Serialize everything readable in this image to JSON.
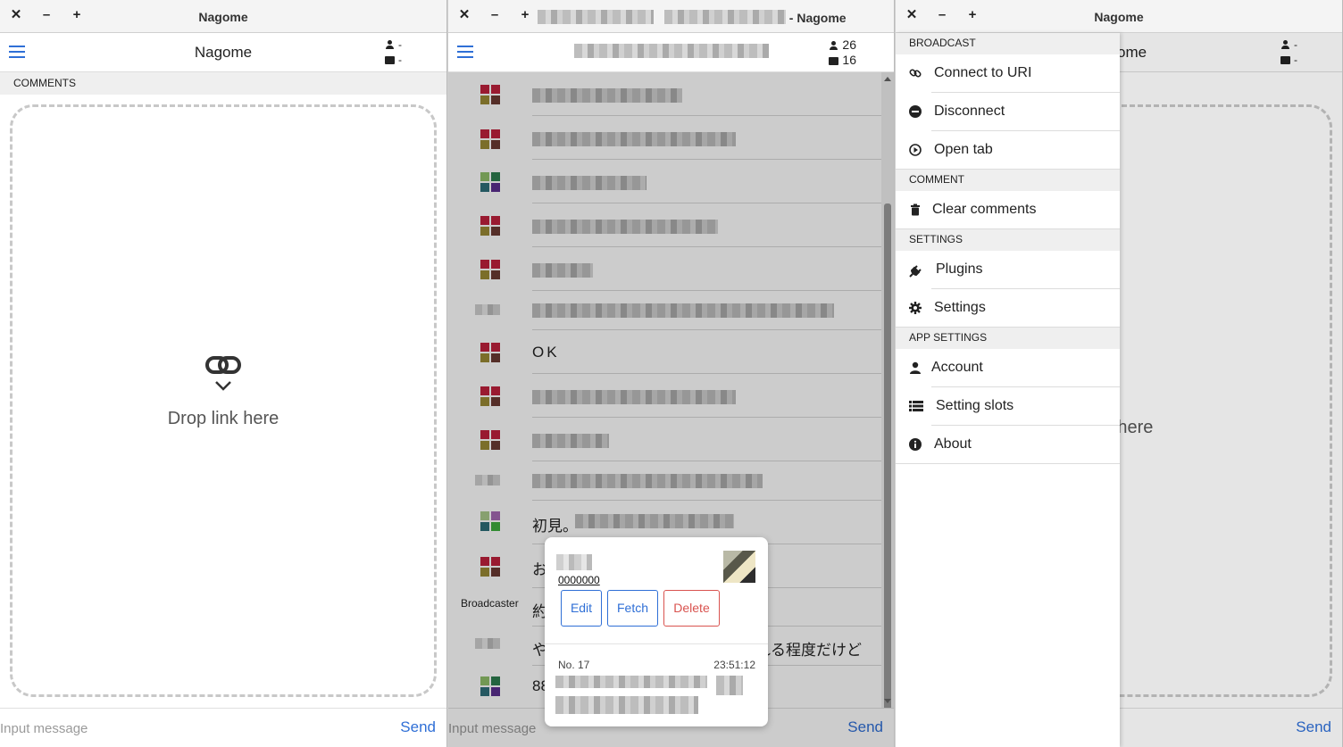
{
  "window_controls": {
    "close": "✕",
    "minimize": "–",
    "maximize": "+"
  },
  "windows": [
    {
      "title": "Nagome",
      "app_title": "Nagome",
      "viewers": "-",
      "comments": "-",
      "section": "COMMENTS",
      "drop_text": "Drop link here",
      "input_placeholder": "Input message",
      "send_label": "Send"
    },
    {
      "title_suffix": "- Nagome",
      "viewers": "26",
      "comments": "16",
      "input_placeholder": "Input message",
      "send_label": "Send",
      "visible_comments": [
        {
          "text": "OK"
        },
        {
          "text": "初見。"
        },
        {
          "text": "お"
        },
        {
          "text": "約",
          "label": "Broadcaster"
        },
        {
          "text": "や",
          "tail": "れる程度だけど"
        },
        {
          "text": "88"
        }
      ],
      "popup": {
        "user_id": "0000000",
        "edit_label": "Edit",
        "fetch_label": "Fetch",
        "delete_label": "Delete",
        "comment_no": "No. 17",
        "time": "23:51:12"
      }
    },
    {
      "title": "Nagome",
      "app_title_partial": "ome",
      "viewers": "-",
      "comments": "-",
      "drop_text_partial": "nk here",
      "send_label": "Send",
      "menu": {
        "broadcast_header": "BROADCAST",
        "connect": "Connect to URI",
        "disconnect": "Disconnect",
        "open_tab": "Open tab",
        "comment_header": "COMMENT",
        "clear": "Clear comments",
        "settings_header": "SETTINGS",
        "plugins": "Plugins",
        "settings": "Settings",
        "app_settings_header": "APP SETTINGS",
        "account": "Account",
        "setting_slots": "Setting slots",
        "about": "About"
      }
    }
  ],
  "colors": {
    "accent": "#2f6fd6",
    "danger": "#d9534f",
    "avatar_red": "#c0213c",
    "avatar_olive": "#9a8a35",
    "avatar_brown": "#6b3a32"
  }
}
